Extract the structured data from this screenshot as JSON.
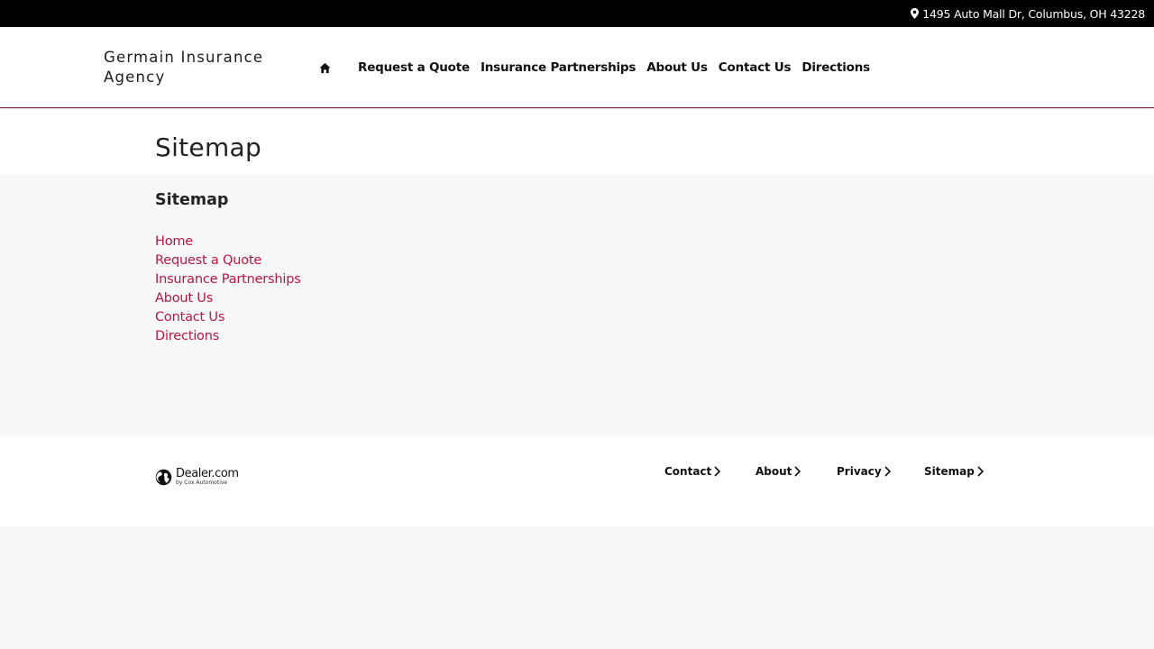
{
  "topbar": {
    "address": "1495 Auto Mall Dr, Columbus, OH 43228",
    "icon": "map-pin-icon"
  },
  "header": {
    "brand": "Germain Insurance Agency",
    "home_icon": "home-icon",
    "nav": [
      "Request a Quote",
      "Insurance Partnerships",
      "About Us",
      "Contact Us",
      "Directions"
    ]
  },
  "page": {
    "title": "Sitemap"
  },
  "sitemap": {
    "heading": "Sitemap",
    "links": [
      "Home",
      "Request a Quote",
      "Insurance Partnerships",
      "About Us",
      "Contact Us",
      "Directions"
    ]
  },
  "footer": {
    "logo": {
      "name": "Dealer.com",
      "tagline": "by Cox Automotive"
    },
    "links": [
      "Contact",
      "About",
      "Privacy",
      "Sitemap"
    ]
  },
  "colors": {
    "accent": "#b5183f",
    "topbar": "#000000",
    "header_border": "#8b1a3a"
  }
}
